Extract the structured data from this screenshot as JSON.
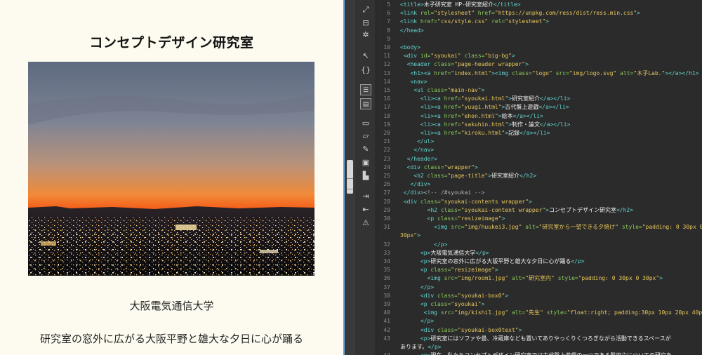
{
  "preview": {
    "heading": "コンセプトデザイン研究室",
    "image_alt": "研究室から一望できる夕焼け",
    "caption_university": "大阪電気通信大学",
    "caption_description": "研究室の窓外に広がる大阪平野と雄大な夕日に心が踊る"
  },
  "toolstrip": {
    "icons": [
      "expand-icon",
      "select-parent-icon",
      "wrap-tag-icon",
      "pointer-icon",
      "bracket-icon",
      "layout-icon",
      "code-panel-icon",
      "comment-icon",
      "uncomment-icon",
      "brush-icon",
      "snippet-icon",
      "chart-icon",
      "indent-icon",
      "outdent-icon",
      "format-icon"
    ]
  },
  "code": {
    "lines": [
      {
        "n": "5",
        "segments": [
          [
            "t",
            "<title>"
          ],
          [
            "x",
            "木子研究室 HP-研究室紹介"
          ],
          [
            "t",
            "</title>"
          ]
        ]
      },
      {
        "n": "6",
        "segments": [
          [
            "t",
            "<link "
          ],
          [
            "a",
            "rel="
          ],
          [
            "s",
            "\"stylesheet\""
          ],
          [
            "a",
            " href="
          ],
          [
            "s",
            "\"https://unpkg.com/ress/dist/ress.min.css\""
          ],
          [
            "t",
            ">"
          ]
        ]
      },
      {
        "n": "7",
        "segments": [
          [
            "t",
            "<link "
          ],
          [
            "a",
            "href="
          ],
          [
            "s",
            "\"css/style.css\""
          ],
          [
            "a",
            " rel="
          ],
          [
            "s",
            "\"stylesheet\""
          ],
          [
            "t",
            ">"
          ]
        ]
      },
      {
        "n": "8",
        "segments": [
          [
            "t",
            "</head>"
          ]
        ]
      },
      {
        "n": "9",
        "segments": []
      },
      {
        "n": "10",
        "segments": [
          [
            "t",
            "<body>"
          ]
        ]
      },
      {
        "n": "11",
        "segments": [
          [
            "x",
            " "
          ],
          [
            "t",
            "<div "
          ],
          [
            "a",
            "id="
          ],
          [
            "s",
            "\"syoukai\""
          ],
          [
            "a",
            " class="
          ],
          [
            "s",
            "\"big-bg\""
          ],
          [
            "t",
            ">"
          ]
        ]
      },
      {
        "n": "12",
        "segments": [
          [
            "x",
            "  "
          ],
          [
            "t",
            "<header "
          ],
          [
            "a",
            "class="
          ],
          [
            "s",
            "\"page-header wrapper\""
          ],
          [
            "t",
            ">"
          ]
        ]
      },
      {
        "n": "13",
        "segments": [
          [
            "x",
            "   "
          ],
          [
            "t",
            "<h1><a "
          ],
          [
            "a",
            "href="
          ],
          [
            "s",
            "\"index.html\""
          ],
          [
            "t",
            "><img "
          ],
          [
            "a",
            "class="
          ],
          [
            "s",
            "\"logo\""
          ],
          [
            "a",
            " src="
          ],
          [
            "s",
            "\"img/logo.svg\""
          ],
          [
            "a",
            " alt="
          ],
          [
            "s",
            "\"木子Lab.\""
          ],
          [
            "t",
            "></a></h1>"
          ]
        ]
      },
      {
        "n": "14",
        "segments": [
          [
            "x",
            "   "
          ],
          [
            "t",
            "<nav>"
          ]
        ]
      },
      {
        "n": "15",
        "segments": [
          [
            "x",
            "    "
          ],
          [
            "t",
            "<ul "
          ],
          [
            "a",
            "class="
          ],
          [
            "s",
            "\"main-nav\""
          ],
          [
            "t",
            ">"
          ]
        ]
      },
      {
        "n": "16",
        "segments": [
          [
            "x",
            "      "
          ],
          [
            "t",
            "<li><a "
          ],
          [
            "a",
            "href="
          ],
          [
            "s",
            "\"syoukai.html\""
          ],
          [
            "t",
            ">"
          ],
          [
            "x",
            "研究室紹介"
          ],
          [
            "t",
            "</a></li>"
          ]
        ]
      },
      {
        "n": "17",
        "segments": [
          [
            "x",
            "      "
          ],
          [
            "t",
            "<li><a "
          ],
          [
            "a",
            "href="
          ],
          [
            "s",
            "\"yuugi.html\""
          ],
          [
            "t",
            ">"
          ],
          [
            "x",
            "古代盤上遊戯"
          ],
          [
            "t",
            "</a></li>"
          ]
        ]
      },
      {
        "n": "18",
        "segments": [
          [
            "x",
            "      "
          ],
          [
            "t",
            "<li><a "
          ],
          [
            "a",
            "href="
          ],
          [
            "s",
            "\"ehon.html\""
          ],
          [
            "t",
            ">"
          ],
          [
            "x",
            "絵本"
          ],
          [
            "t",
            "</a></li>"
          ]
        ]
      },
      {
        "n": "19",
        "segments": [
          [
            "x",
            "      "
          ],
          [
            "t",
            "<li><a "
          ],
          [
            "a",
            "href="
          ],
          [
            "s",
            "\"sakuhin.html\""
          ],
          [
            "t",
            ">"
          ],
          [
            "x",
            "制作・論文"
          ],
          [
            "t",
            "</a></li>"
          ]
        ]
      },
      {
        "n": "20",
        "segments": [
          [
            "x",
            "      "
          ],
          [
            "t",
            "<li><a "
          ],
          [
            "a",
            "href="
          ],
          [
            "s",
            "\"kiroku.html\""
          ],
          [
            "t",
            ">"
          ],
          [
            "x",
            "記録"
          ],
          [
            "t",
            "</a></li>"
          ]
        ]
      },
      {
        "n": "21",
        "segments": [
          [
            "x",
            "     "
          ],
          [
            "t",
            "</ul>"
          ]
        ]
      },
      {
        "n": "22",
        "segments": [
          [
            "x",
            "    "
          ],
          [
            "t",
            "</nav>"
          ]
        ]
      },
      {
        "n": "23",
        "segments": [
          [
            "x",
            "  "
          ],
          [
            "t",
            "</header>"
          ]
        ]
      },
      {
        "n": "24",
        "segments": [
          [
            "x",
            "  "
          ],
          [
            "t",
            "<div "
          ],
          [
            "a",
            "class="
          ],
          [
            "s",
            "\"wrapper\""
          ],
          [
            "t",
            ">"
          ]
        ]
      },
      {
        "n": "25",
        "segments": [
          [
            "x",
            "    "
          ],
          [
            "t",
            "<h2 "
          ],
          [
            "a",
            "class="
          ],
          [
            "s",
            "\"page-title\""
          ],
          [
            "t",
            ">"
          ],
          [
            "x",
            "研究室紹介"
          ],
          [
            "t",
            "</h2>"
          ]
        ]
      },
      {
        "n": "26",
        "segments": [
          [
            "x",
            "   "
          ],
          [
            "t",
            "</div>"
          ]
        ]
      },
      {
        "n": "27",
        "segments": [
          [
            "x",
            " "
          ],
          [
            "t",
            "</div>"
          ],
          [
            "c",
            "<!-- /#syoukai -->"
          ]
        ]
      },
      {
        "n": "28",
        "segments": [
          [
            "x",
            " "
          ],
          [
            "t",
            "<div "
          ],
          [
            "a",
            "class="
          ],
          [
            "s",
            "\"syoukai-contents wrapper\""
          ],
          [
            "t",
            ">"
          ]
        ]
      },
      {
        "n": "29",
        "segments": [
          [
            "x",
            "        "
          ],
          [
            "t",
            "<h2 "
          ],
          [
            "a",
            "class="
          ],
          [
            "s",
            "\"syoukai-content wrapper\""
          ],
          [
            "t",
            ">"
          ],
          [
            "x",
            "コンセプトデザイン研究室"
          ],
          [
            "t",
            "</h2>"
          ]
        ]
      },
      {
        "n": "30",
        "segments": [
          [
            "x",
            "        "
          ],
          [
            "t",
            "<p "
          ],
          [
            "a",
            "class="
          ],
          [
            "s",
            "\"resizeimage\""
          ],
          [
            "t",
            ">"
          ]
        ]
      },
      {
        "n": "31",
        "segments": [
          [
            "x",
            "          "
          ],
          [
            "t",
            "<img "
          ],
          [
            "a",
            "src="
          ],
          [
            "s",
            "\"img/huukei3.jpg\""
          ],
          [
            "a",
            " alt="
          ],
          [
            "s",
            "\"研究室から一望できる夕焼け\""
          ],
          [
            "a",
            " style="
          ],
          [
            "s",
            "\"padding: 0 30px 0"
          ]
        ]
      },
      {
        "n": "",
        "segments": [
          [
            "s",
            "30px\""
          ],
          [
            "t",
            ">"
          ]
        ]
      },
      {
        "n": "32",
        "segments": [
          [
            "x",
            "          "
          ],
          [
            "t",
            "</p>"
          ]
        ]
      },
      {
        "n": "33",
        "segments": [
          [
            "x",
            "      "
          ],
          [
            "t",
            "<p>"
          ],
          [
            "x",
            "大阪電気通信大学"
          ],
          [
            "t",
            "</p>"
          ]
        ]
      },
      {
        "n": "34",
        "segments": [
          [
            "x",
            "      "
          ],
          [
            "t",
            "<p>"
          ],
          [
            "x",
            "研究室の窓外に広がる大阪平野と雄大な夕日に心が踊る"
          ],
          [
            "t",
            "</p>"
          ]
        ]
      },
      {
        "n": "35",
        "segments": [
          [
            "x",
            "      "
          ],
          [
            "t",
            "<p "
          ],
          [
            "a",
            "class="
          ],
          [
            "s",
            "\"resizeimage\""
          ],
          [
            "t",
            ">"
          ]
        ]
      },
      {
        "n": "36",
        "segments": [
          [
            "x",
            "        "
          ],
          [
            "t",
            "<img "
          ],
          [
            "a",
            "src="
          ],
          [
            "s",
            "\"img/room1.jpg\""
          ],
          [
            "a",
            " alt="
          ],
          [
            "s",
            "\"研究室内\""
          ],
          [
            "a",
            " style="
          ],
          [
            "s",
            "\"padding: 0 30px 0 30px\""
          ],
          [
            "t",
            ">"
          ]
        ]
      },
      {
        "n": "37",
        "segments": [
          [
            "x",
            "      "
          ],
          [
            "t",
            "</p>"
          ]
        ]
      },
      {
        "n": "38",
        "segments": [
          [
            "x",
            "      "
          ],
          [
            "t",
            "<div "
          ],
          [
            "a",
            "class="
          ],
          [
            "s",
            "\"syoukai-box0\""
          ],
          [
            "t",
            ">"
          ]
        ]
      },
      {
        "n": "39",
        "segments": [
          [
            "x",
            "      "
          ],
          [
            "t",
            "<p "
          ],
          [
            "a",
            "class="
          ],
          [
            "s",
            "\"syoukai\""
          ],
          [
            "t",
            ">"
          ]
        ]
      },
      {
        "n": "40",
        "segments": [
          [
            "x",
            "       "
          ],
          [
            "t",
            "<img "
          ],
          [
            "a",
            "src="
          ],
          [
            "s",
            "\"img/kishi1.jpg\""
          ],
          [
            "a",
            " alt="
          ],
          [
            "s",
            "\"先生\""
          ],
          [
            "a",
            " style="
          ],
          [
            "s",
            "\"float:right; padding:30px 10px 20px 40px;\""
          ],
          [
            "t",
            ">"
          ]
        ]
      },
      {
        "n": "41",
        "segments": [
          [
            "x",
            "      "
          ],
          [
            "t",
            "</p>"
          ]
        ]
      },
      {
        "n": "42",
        "segments": [
          [
            "x",
            "      "
          ],
          [
            "t",
            "<div "
          ],
          [
            "a",
            "class="
          ],
          [
            "s",
            "\"syoukai-box0text\""
          ],
          [
            "t",
            ">"
          ]
        ]
      },
      {
        "n": "43",
        "segments": [
          [
            "x",
            "      "
          ],
          [
            "t",
            "<p>"
          ],
          [
            "x",
            "研究室にはソファや畳、冷蔵庫なども置いてありやっくりくつろぎながら活動できるスペースが"
          ]
        ]
      },
      {
        "n": "",
        "segments": [
          [
            "x",
            "あります。"
          ],
          [
            "t",
            "</p>"
          ]
        ]
      },
      {
        "n": "44",
        "segments": [
          [
            "x",
            "      "
          ],
          [
            "t",
            "<p>"
          ],
          [
            "x",
            "現在、私たちコンセプトデザイン研究室では古代盤上遊戯の一つである盤双六についての研究を"
          ]
        ]
      }
    ]
  }
}
